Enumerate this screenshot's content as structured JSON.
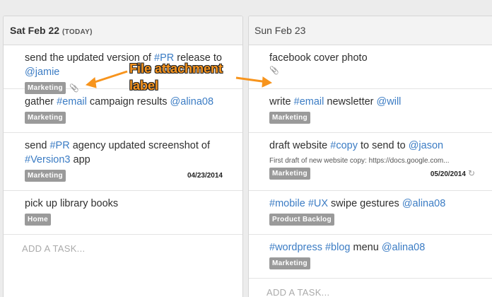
{
  "columns": [
    {
      "title": "Sat Feb 22",
      "today_tag": "(TODAY)",
      "tasks": [
        {
          "parts": [
            {
              "text": "send the updated version of "
            },
            {
              "text": "#PR",
              "tag": true
            },
            {
              "text": " release to "
            },
            {
              "text": "@jamie",
              "tag": true
            }
          ],
          "label": "Marketing",
          "attachment_icon": "paperclip-icon",
          "attachment": true
        },
        {
          "parts": [
            {
              "text": "gather "
            },
            {
              "text": "#email",
              "tag": true
            },
            {
              "text": " campaign results "
            },
            {
              "text": "@alina08",
              "tag": true
            }
          ],
          "label": "Marketing"
        },
        {
          "parts": [
            {
              "text": "send "
            },
            {
              "text": "#PR",
              "tag": true
            },
            {
              "text": " agency updated screenshot of "
            },
            {
              "text": "#Version3",
              "tag": true
            },
            {
              "text": " app"
            }
          ],
          "label": "Marketing",
          "due": "04/23/2014"
        },
        {
          "parts": [
            {
              "text": "pick up library books"
            }
          ],
          "label": "Home"
        }
      ],
      "add_task": "ADD A TASK..."
    },
    {
      "title": "Sun Feb 23",
      "tasks": [
        {
          "parts": [
            {
              "text": "facebook cover photo"
            }
          ],
          "attachment_icon": "paperclip-icon",
          "attachment": true
        },
        {
          "parts": [
            {
              "text": "write "
            },
            {
              "text": "#email",
              "tag": true
            },
            {
              "text": " newsletter "
            },
            {
              "text": "@will",
              "tag": true
            }
          ],
          "label": "Marketing"
        },
        {
          "parts": [
            {
              "text": "draft website "
            },
            {
              "text": "#copy",
              "tag": true
            },
            {
              "text": " to send to "
            },
            {
              "text": "@jason",
              "tag": true
            }
          ],
          "note": "First draft of new website copy: https://docs.google.com...",
          "label": "Marketing",
          "due": "05/20/2014",
          "repeat_icon": "repeat-icon",
          "repeat": true
        },
        {
          "parts": [
            {
              "text": "#mobile",
              "tag": true
            },
            {
              "text": " "
            },
            {
              "text": "#UX",
              "tag": true
            },
            {
              "text": " swipe gestures "
            },
            {
              "text": "@alina08",
              "tag": true
            }
          ],
          "label": "Product Backlog"
        },
        {
          "parts": [
            {
              "text": "#wordpress",
              "tag": true
            },
            {
              "text": " "
            },
            {
              "text": "#blog",
              "tag": true
            },
            {
              "text": " menu "
            },
            {
              "text": "@alina08",
              "tag": true
            }
          ],
          "label": "Marketing"
        }
      ],
      "add_task": "ADD A TASK..."
    }
  ],
  "annotation": {
    "line1": "File attachment",
    "line2": "label",
    "color": "#f7941d"
  },
  "colors": {
    "tag": "#3b7cc4",
    "label_bg": "#9a9a9a"
  }
}
